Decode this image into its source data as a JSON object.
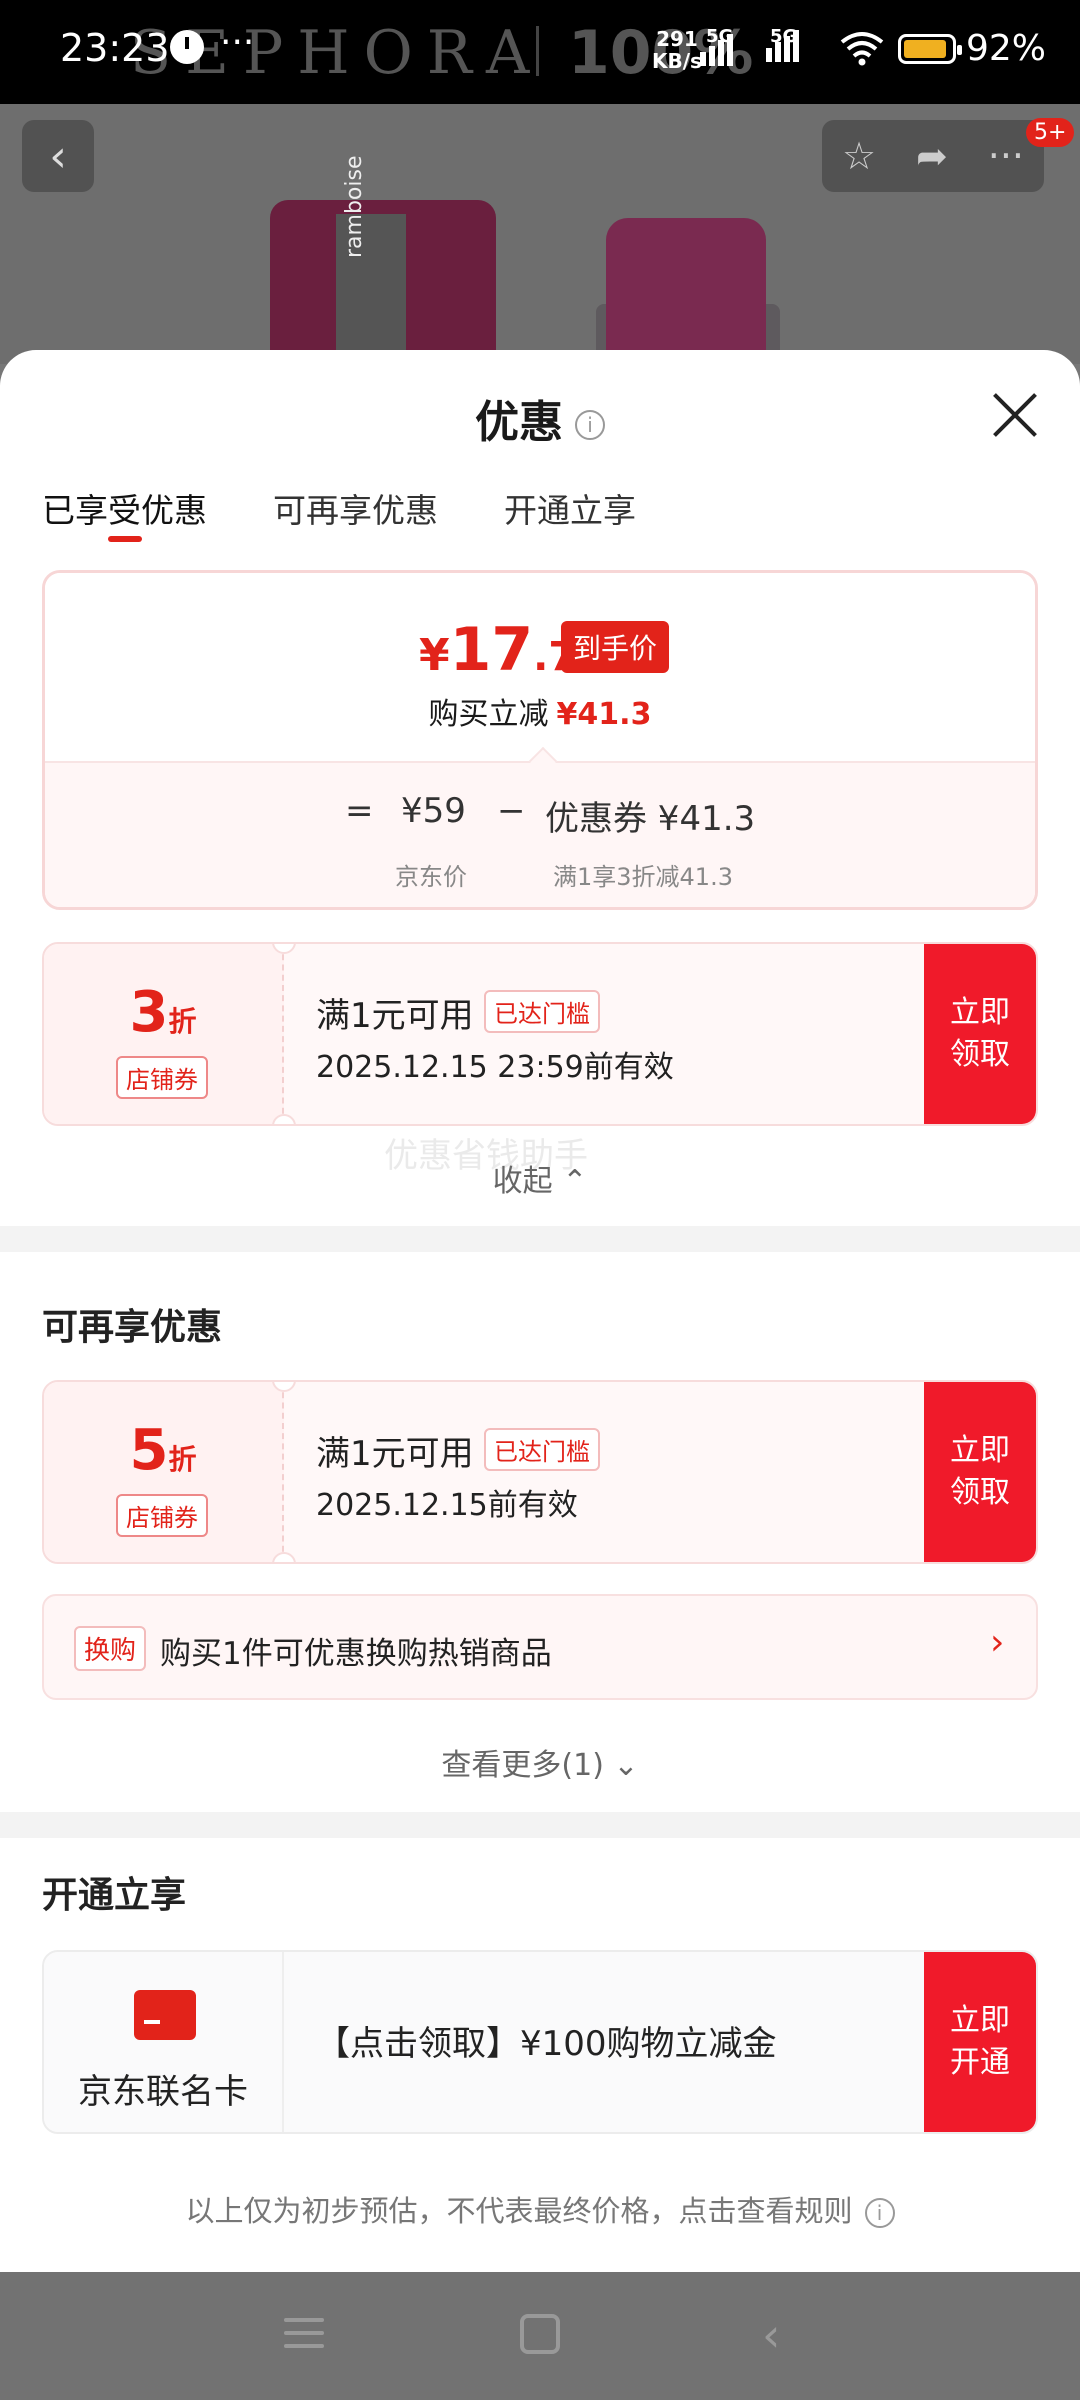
{
  "status_bar": {
    "time": "23:23",
    "dots": "···",
    "watermark_brand": "SEPHORA",
    "watermark_right": "100%",
    "speed_value": "291",
    "speed_unit": "KB/s",
    "net1": "5G",
    "net2": "5G",
    "battery_pct": "92%",
    "battery_level": 0.92
  },
  "product": {
    "tube_text": "ramboise",
    "cart_badge": "5+"
  },
  "sheet": {
    "title": "优惠",
    "tabs": [
      "已享受优惠",
      "可再享优惠",
      "开通立享"
    ]
  },
  "price_card": {
    "yen": "¥",
    "price_int": "17",
    "price_dec": ".7",
    "price_tag": "到手价",
    "reduce_label": "购买立减",
    "reduce_amount": "¥41.3",
    "eq": "=",
    "jd_price": "¥59",
    "minus": "−",
    "coupon_label": "优惠券 ¥41.3",
    "jd_price_label": "京东价",
    "coupon_desc": "满1享3折减41.3"
  },
  "enjoyed_coupon": {
    "discount_num": "3",
    "discount_unit": "折",
    "type": "店铺券",
    "condition": "满1元可用",
    "status": "已达门槛",
    "valid": "2025.12.15 23:59前有效",
    "btn_line1": "立即",
    "btn_line2": "领取"
  },
  "collapse_label": "收起 ⌃",
  "assistant_watermark": "优惠省钱助手",
  "more_section": {
    "title": "可再享优惠",
    "coupon": {
      "discount_num": "5",
      "discount_unit": "折",
      "type": "店铺券",
      "condition": "满1元可用",
      "status": "已达门槛",
      "valid": "2025.12.15前有效",
      "btn_line1": "立即",
      "btn_line2": "领取"
    },
    "swap": {
      "tag": "换购",
      "text": "购买1件可优惠换购热销商品"
    },
    "see_more": "查看更多(1) ⌄"
  },
  "open_section": {
    "title": "开通立享",
    "card_name": "京东联名卡",
    "offer": "【点击领取】¥100购物立减金",
    "btn_line1": "立即",
    "btn_line2": "开通"
  },
  "disclaimer": "以上仅为初步预估，不代表最终价格，点击查看规则",
  "colors": {
    "accent_red": "#e2231a",
    "button_red": "#f01a2a",
    "coupon_bg": "#fff8f8"
  },
  "icons": [
    "back-icon",
    "star-icon",
    "share-icon",
    "more-icon",
    "info-icon",
    "close-icon",
    "chevron-right-icon",
    "card-icon",
    "menu-icon",
    "home-icon",
    "nav-back-icon"
  ]
}
